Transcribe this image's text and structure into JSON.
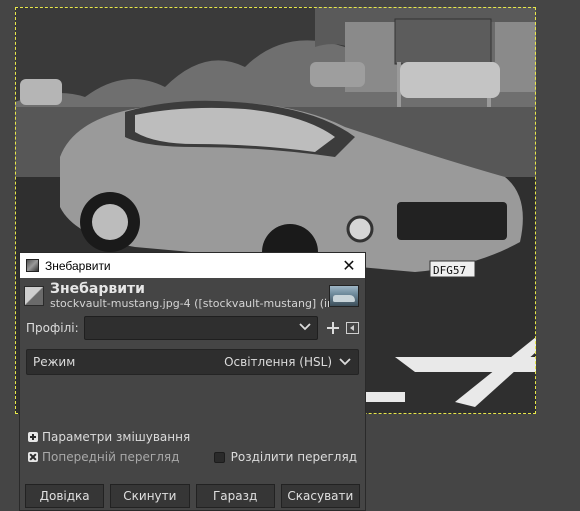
{
  "dialog": {
    "window_title": "Знебарвити",
    "header_title": "Знебарвити",
    "header_subtitle": "stockvault-mustang.jpg-4 ([stockvault-mustang] (імп...",
    "presets_label": "Профілі:",
    "presets_value": "",
    "mode_label": "Режим",
    "mode_value": "Освітлення (HSL)",
    "blending_options_label": "Параметри змішування",
    "preview_label": "Попередній перегляд",
    "preview_checked": true,
    "split_view_label": "Розділити перегляд",
    "split_view_checked": false,
    "buttons": {
      "help": "Довідка",
      "reset": "Скинути",
      "ok": "Гаразд",
      "cancel": "Скасувати"
    }
  },
  "canvas": {
    "image_description_colors": {
      "selection_border": "#e8e84a"
    },
    "license_plate": "DFG57"
  },
  "icons": {
    "close": "close-icon",
    "add_preset": "plus-icon",
    "presets_menu": "menu-arrow-icon",
    "dropdown": "chevron-down-icon",
    "expander": "expander-plus-icon"
  }
}
